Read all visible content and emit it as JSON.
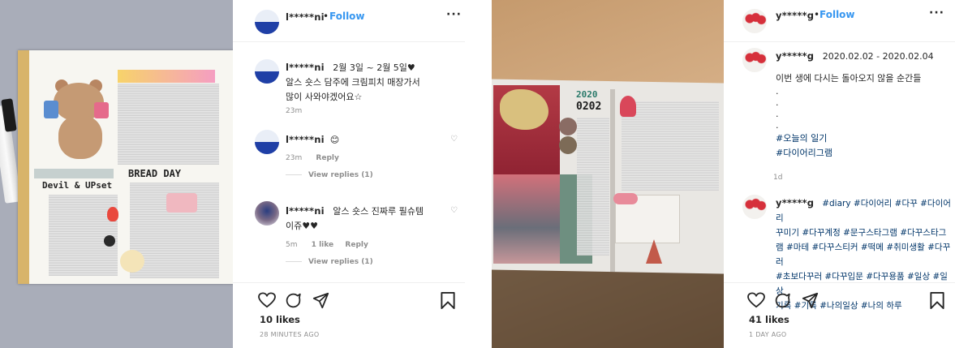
{
  "post1": {
    "username": "l*****ni",
    "follow_label": "Follow",
    "separator": "•",
    "caption_user": "l*****ni",
    "caption_text": "2월 3일 ~ 2월 5일♥",
    "caption_body_1": "알스 숏스 담주에 크림피치 매장가서",
    "caption_body_2": "많이 사와야겠어요☆",
    "caption_time": "23m",
    "comments": [
      {
        "user": "l*****ni",
        "text": "😊",
        "time": "23m",
        "likes": "",
        "reply": "Reply",
        "view_replies": "View replies (1)"
      },
      {
        "user": "l*****ni",
        "text": "알스 숏스 진짜루 필슈템",
        "text2": "이쥬♥♥",
        "time": "5m",
        "likes": "1 like",
        "reply": "Reply",
        "view_replies": "View replies (1)"
      }
    ],
    "likes": "10 likes",
    "time_ago": "28 MINUTES AGO",
    "photo_text_1": "Devil & UPset",
    "photo_text_2": "BREAD DAY"
  },
  "post2": {
    "username": "y*****g",
    "follow_label": "Follow",
    "separator": "•",
    "caption_user": "y*****g",
    "caption_date": "2020.02.02 - 2020.02.04",
    "caption_line": "이번 생에 다시는 돌아오지 않을 순간들",
    "caption_dots": [
      ".",
      ".",
      ".",
      "."
    ],
    "caption_tags": [
      "#오늘의 일기",
      "#다이어리그램"
    ],
    "caption_time": "1d",
    "comment_user": "y*****g",
    "comment_tags_1": "#diary #다이어리 #다꾸 #다이어리",
    "comment_tags_2": "꾸미기 #다꾸계정 #문구스타그램 #다꾸스타그",
    "comment_tags_3": "램 #마테 #다꾸스티커 #떡메 #취미생활 #다꾸러",
    "comment_tags_4": "#초보다꾸러 #다꾸입문 #다꾸용품 #일상 #일상",
    "comment_tags_5": "기록 #기록 #나의일상 #나의 하루",
    "likes": "41 likes",
    "time_ago": "1 DAY AGO",
    "photo_text_1": "2020",
    "photo_text_2": "0202"
  },
  "icons": {
    "heart": "heart-icon",
    "comment": "comment-icon",
    "share": "share-icon",
    "bookmark": "bookmark-icon",
    "more": "more-icon"
  },
  "colors": {
    "follow": "#3897f0",
    "text": "#262626",
    "meta": "#8e8e8e",
    "hashtag": "#003569"
  }
}
